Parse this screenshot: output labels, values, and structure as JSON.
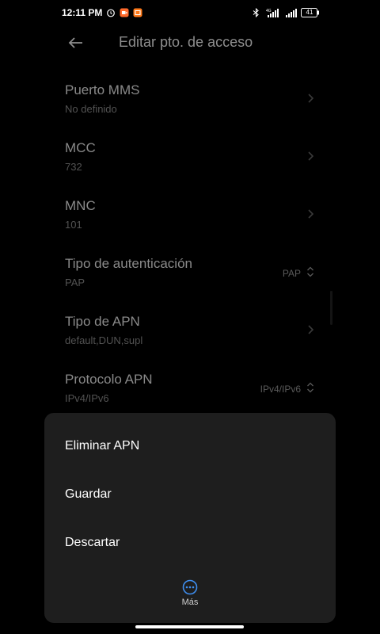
{
  "status_bar": {
    "time": "12:11 PM",
    "icons": [
      "alarm-icon",
      "screen-record-icon",
      "app-notification-icon",
      "bluetooth-icon",
      "4g-signal-icon",
      "signal-icon",
      "battery-icon"
    ],
    "battery": "41"
  },
  "header": {
    "title": "Editar pto. de acceso",
    "back_icon": "arrow-left-icon"
  },
  "settings": [
    {
      "label": "Puerto MMS",
      "value": "No definido",
      "control": "chevron"
    },
    {
      "label": "MCC",
      "value": "732",
      "control": "chevron"
    },
    {
      "label": "MNC",
      "value": "101",
      "control": "chevron"
    },
    {
      "label": "Tipo de autenticación",
      "value": "PAP",
      "selected": "PAP",
      "control": "select"
    },
    {
      "label": "Tipo de APN",
      "value": "default,DUN,supl",
      "control": "chevron"
    },
    {
      "label": "Protocolo APN",
      "value": "IPv4/IPv6",
      "selected": "IPv4/IPv6",
      "control": "select"
    }
  ],
  "menu": {
    "items": [
      "Eliminar APN",
      "Guardar",
      "Descartar"
    ],
    "more_label": "Más"
  },
  "colors": {
    "background": "#000000",
    "sheet": "#1e1e1e",
    "accent": "#3e8ef0"
  }
}
